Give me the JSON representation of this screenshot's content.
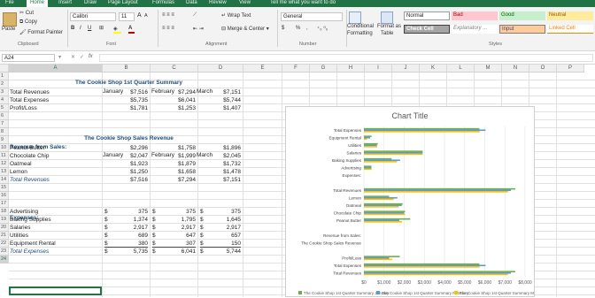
{
  "ribbon": {
    "tabs": [
      "File",
      "Home",
      "Insert",
      "Draw",
      "Page Layout",
      "Formulas",
      "Data",
      "Review",
      "View",
      "Tell me what you want to do"
    ],
    "clipboard": {
      "paste": "Paste",
      "cut": "Cut",
      "copy": "Copy",
      "format_painter": "Format Painter",
      "label": "Clipboard"
    },
    "font": {
      "name": "Calibri",
      "size": "11",
      "grow": "A",
      "shrink": "A",
      "label": "Font"
    },
    "alignment": {
      "wrap_text": "Wrap Text",
      "merge_center": "Merge & Center",
      "label": "Alignment"
    },
    "number": {
      "format": "General",
      "currency": "$",
      "percent": "%",
      "comma": ",",
      "label": "Number"
    },
    "styles": {
      "conditional": "Conditional",
      "conditional2": "Formatting",
      "format_as": "Format as",
      "format_as2": "Table",
      "normal": "Normal",
      "bad": "Bad",
      "good": "Good",
      "neutral": "Neutral",
      "check_cell": "Check Cell",
      "explanatory": "Explanatory ...",
      "input": "Input",
      "linked_cell": "Linked Cell",
      "label": "Styles"
    }
  },
  "formula_bar": {
    "name_box": "A24",
    "fx": "fx",
    "value": ""
  },
  "columns": [
    "A",
    "B",
    "C",
    "D",
    "E",
    "F",
    "G",
    "H",
    "I",
    "J",
    "K",
    "L",
    "M",
    "N",
    "O",
    "P"
  ],
  "rows": [
    "1",
    "2",
    "3",
    "4",
    "5",
    "6",
    "7",
    "8",
    "9",
    "10",
    "11",
    "12",
    "13",
    "14",
    "15",
    "16",
    "17",
    "18",
    "19",
    "20",
    "21",
    "22",
    "23",
    "24"
  ],
  "sheet": {
    "title1": "The Cookie Shop 1st Quarter Summary",
    "months": [
      "January",
      "February",
      "March"
    ],
    "summary": [
      {
        "label": "Total Revenues",
        "values": [
          "$7,516",
          "$7,294",
          "$7,151"
        ]
      },
      {
        "label": "Total Expenses",
        "values": [
          "$5,735",
          "$6,041",
          "$5,744"
        ]
      },
      {
        "label": "Profit/Loss",
        "values": [
          "$1,781",
          "$1,253",
          "$1,407"
        ]
      }
    ],
    "title2": "The Cookie Shop Sales Revenue",
    "rev_header": "Revenue from Sales:",
    "revenue": [
      {
        "label": "Peanut Butter",
        "values": [
          "$2,296",
          "$1,758",
          "$1,896"
        ]
      },
      {
        "label": "Chocolate Chip",
        "values": [
          "$2,047",
          "$1,999",
          "$2,045"
        ]
      },
      {
        "label": "Oatmeal",
        "values": [
          "$1,923",
          "$1,879",
          "$1,732"
        ]
      },
      {
        "label": "Lemon",
        "values": [
          "$1,250",
          "$1,658",
          "$1,478"
        ]
      }
    ],
    "total_revenues": {
      "label": "Total Revenues",
      "values": [
        "$7,516",
        "$7,294",
        "$7,151"
      ]
    },
    "exp_header": "Expenses:",
    "expenses": [
      {
        "label": "Advertising",
        "values": [
          "375",
          "375",
          "375"
        ]
      },
      {
        "label": "Baking Supplies",
        "values": [
          "1,374",
          "1,795",
          "1,645"
        ]
      },
      {
        "label": "Salaries",
        "values": [
          "2,917",
          "2,917",
          "2,917"
        ]
      },
      {
        "label": "Utilities",
        "values": [
          "689",
          "647",
          "657"
        ]
      },
      {
        "label": "Equipment Rental",
        "values": [
          "380",
          "307",
          "150"
        ]
      }
    ],
    "total_expenses": {
      "label": "Total Expenses",
      "values": [
        "5,735",
        "6,041",
        "5,744"
      ]
    },
    "dollar": "$"
  },
  "chart_data": {
    "type": "bar",
    "title": "Chart Title",
    "orientation": "horizontal",
    "categories": [
      "Total Expenses",
      "Equipment Rental",
      "Utilities",
      "Salaries",
      "Baking Supplies",
      "Advertising",
      "Expenses:",
      "",
      "Total Revenues",
      "Lemon",
      "Oatmeal",
      "Chocolate Chip",
      "Peanut Butter",
      "",
      "Revenue from Sales:",
      "The Cookie Shop Sales Revenue",
      "",
      "Profit/Loss",
      "Total Expenses",
      "Total Revenues"
    ],
    "series": [
      {
        "name": "The Cookie Shop 1st Quarter Summary March",
        "color": "#ffc000",
        "values": [
          5744,
          150,
          657,
          2917,
          1645,
          375,
          0,
          0,
          7151,
          1478,
          1732,
          2045,
          1896,
          0,
          0,
          0,
          0,
          1407,
          5744,
          7151
        ]
      },
      {
        "name": "The Cookie Shop 1st Quarter Summary February",
        "color": "#5b9bd5",
        "values": [
          6041,
          307,
          647,
          2917,
          1795,
          375,
          0,
          0,
          7294,
          1658,
          1879,
          1999,
          1758,
          0,
          0,
          0,
          0,
          1253,
          6041,
          7294
        ]
      },
      {
        "name": "The Cookie Shop 1st Quarter Summary January",
        "color": "#70ad47",
        "values": [
          5735,
          380,
          689,
          2917,
          1374,
          375,
          0,
          0,
          7516,
          1250,
          1923,
          2047,
          2296,
          0,
          0,
          0,
          0,
          1781,
          5735,
          7516
        ]
      }
    ],
    "xticks": [
      "$0",
      "$1,000",
      "$2,000",
      "$3,000",
      "$4,000",
      "$5,000",
      "$6,000",
      "$7,000",
      "$8,000"
    ],
    "xlim": [
      0,
      8000
    ],
    "grid": true,
    "legend": "bottom"
  }
}
